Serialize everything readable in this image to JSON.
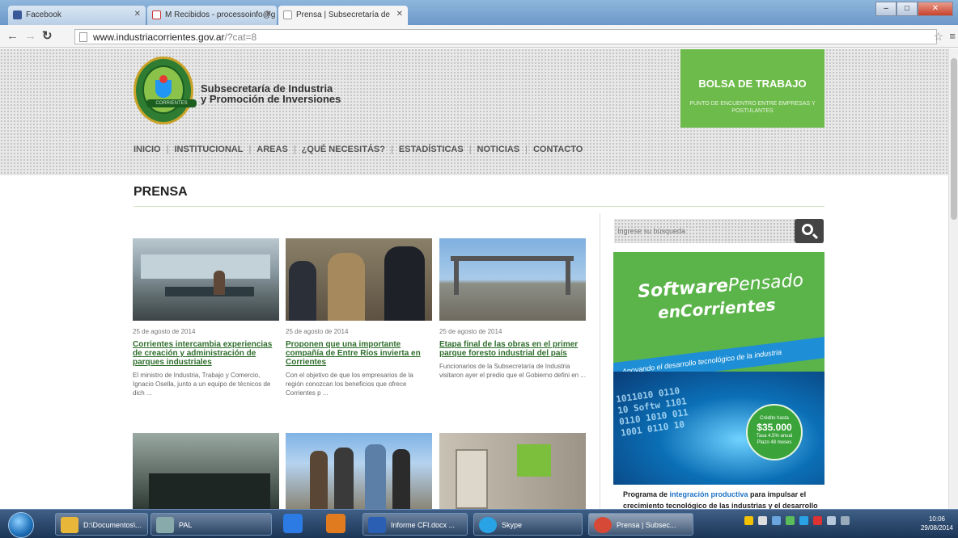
{
  "browser": {
    "tabs": [
      {
        "label": "Facebook",
        "icon": "facebook-icon",
        "active": false
      },
      {
        "label": "M Recibidos - processoinfo@g",
        "icon": "gmail-icon",
        "active": false
      },
      {
        "label": "Prensa | Subsecretaría de",
        "icon": "page-icon",
        "active": true
      }
    ],
    "url_domain": "www.industriacorrientes.gov.ar",
    "url_path": "/?cat=8"
  },
  "site": {
    "title_line1": "Subsecretaría de Industria",
    "title_line2": "y Promoción de Inversiones",
    "logo_text": "CORRIENTES",
    "bolsa_title": "BOLSA DE TRABAJO",
    "bolsa_subtitle": "PUNTO DE ENCUENTRO ENTRE EMPRESAS Y POSTULANTES",
    "nav": [
      "INICIO",
      "INSTITUCIONAL",
      "AREAS",
      "¿QUÉ NECESITÁS?",
      "ESTADÍSTICAS",
      "NOTICIAS",
      "CONTACTO"
    ]
  },
  "main": {
    "page_title": "PRENSA",
    "articles": [
      {
        "date": "25 de agosto de 2014",
        "title": "Corrientes intercambia experiencias de creación y administración de parques industriales",
        "excerpt": "El ministro de Industria, Trabajo y Comercio, Ignacio Osella, junto a un equipo de técnicos de dich ..."
      },
      {
        "date": "25 de agosto de 2014",
        "title": "Proponen que una importante compañía de Entre Ríos invierta en Corrientes",
        "excerpt": "Con el objetivo de que los empresarios de la región conozcan los beneficios que ofrece Corrientes p ..."
      },
      {
        "date": "25 de agosto de 2014",
        "title": "Etapa final de las obras en el primer parque foresto industrial del país",
        "excerpt": "Funcionarios de la Subsecretaría de Industria visitaron ayer el predio que el Gobierno defini en ..."
      }
    ]
  },
  "sidebar": {
    "search_placeholder": "Ingrese su búsqueda",
    "banner_line1a": "Software",
    "banner_line1b": "Pensado",
    "banner_line2": "enCorrientes",
    "banner_strip": "Apoyando el desarrollo tecnológico de la industria",
    "badge_line1": "Crédito hasta",
    "badge_amount": "$35.000",
    "badge_line2": "Tasa 4.5% anual",
    "badge_line3": "Plazo 48 meses",
    "program_text_a": "Programa de ",
    "program_text_hl": "integración productiva",
    "program_text_b": " para impulsar el crecimiento tecnológico de las industrias y el desarrollo"
  },
  "taskbar": {
    "buttons": [
      {
        "label": "D:\\Documentos\\...",
        "icon": "folder-icon",
        "color": "#e8b73a"
      },
      {
        "label": "PAL",
        "icon": "app-icon",
        "color": "#8aa"
      },
      {
        "label": "Informe CFI.docx ...",
        "icon": "word-icon",
        "color": "#2b5fb4"
      },
      {
        "label": "Skype",
        "icon": "skype-icon",
        "color": "#2aa3e6"
      },
      {
        "label": "Prensa | Subsec...",
        "icon": "chrome-icon",
        "color": "#d64937"
      }
    ],
    "time": "10:06",
    "date": "29/08/2014"
  }
}
